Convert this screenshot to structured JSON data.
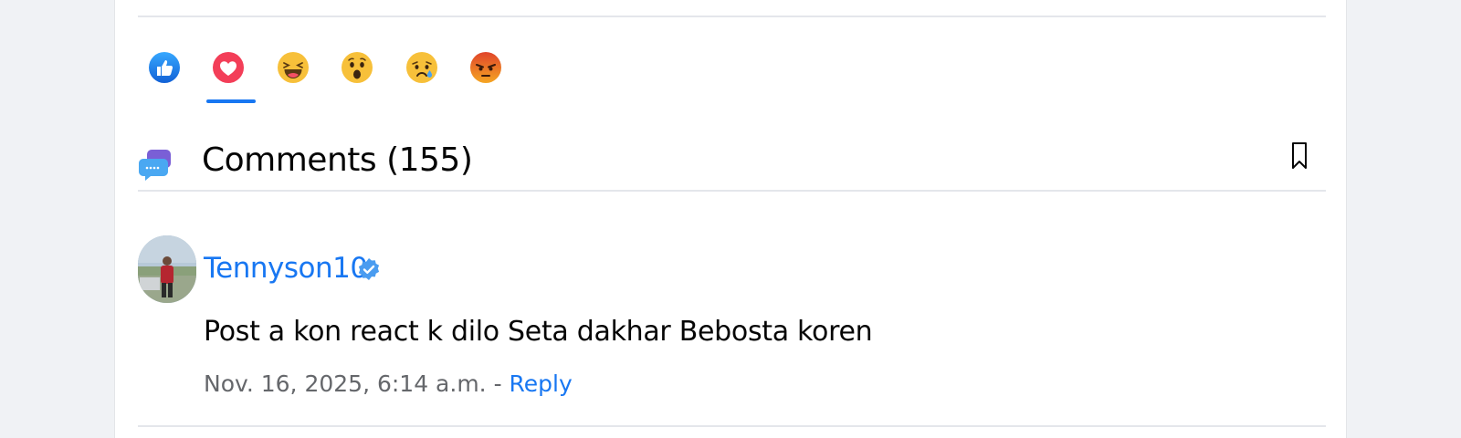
{
  "reactions": {
    "items": [
      {
        "name": "like",
        "color": "#1877f2"
      },
      {
        "name": "love",
        "color": "#f33e58"
      },
      {
        "name": "haha",
        "color": "#f7b125"
      },
      {
        "name": "wow",
        "color": "#f7b125"
      },
      {
        "name": "sad",
        "color": "#f7b125"
      },
      {
        "name": "angry",
        "color": "#e9710f"
      }
    ],
    "selected": "love"
  },
  "comments": {
    "title": "Comments (155)"
  },
  "comment": {
    "username": "Tennyson10",
    "text": "Post a kon react k dilo Seta dakhar Bebosta koren",
    "timestamp": "Nov. 16, 2025, 6:14 a.m.",
    "separator": " - ",
    "reply_label": "Reply"
  },
  "colors": {
    "accent": "#1877f2",
    "divider": "#e4e6eb",
    "muted_text": "#65676b"
  }
}
